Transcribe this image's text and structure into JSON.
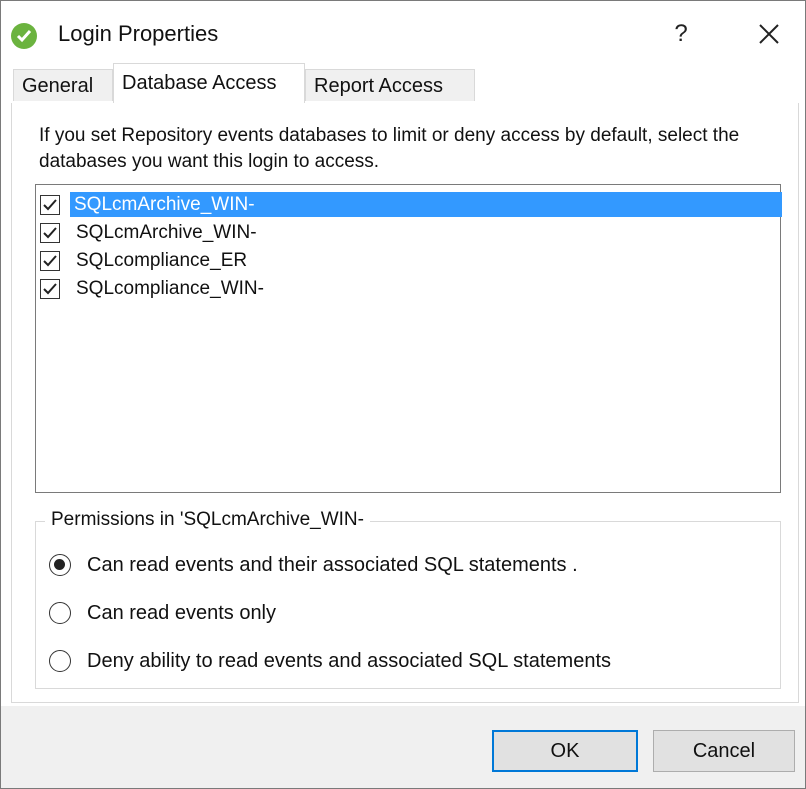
{
  "window": {
    "title": "Login Properties",
    "help_glyph": "?",
    "accent_color": "#6bb33f"
  },
  "tabs": [
    {
      "label": "General",
      "active": false
    },
    {
      "label": "Database Access",
      "active": true
    },
    {
      "label": "Report Access",
      "active": false
    }
  ],
  "database_access": {
    "description": "If you set Repository events databases to limit or deny access by default, select the databases you want this login to access.",
    "databases": [
      {
        "name": "SQLcmArchive_WIN-",
        "checked": true,
        "selected": true
      },
      {
        "name": "SQLcmArchive_WIN-",
        "checked": true,
        "selected": false
      },
      {
        "name": "SQLcompliance_ER",
        "checked": true,
        "selected": false
      },
      {
        "name": "SQLcompliance_WIN-",
        "checked": true,
        "selected": false
      }
    ],
    "permissions": {
      "legend": "Permissions in 'SQLcmArchive_WIN-",
      "options": [
        {
          "label": "Can read events and their associated SQL statements .",
          "selected": true
        },
        {
          "label": "Can read events only",
          "selected": false
        },
        {
          "label": "Deny ability to read events and associated SQL statements",
          "selected": false
        }
      ]
    }
  },
  "buttons": {
    "ok": "OK",
    "cancel": "Cancel"
  },
  "icons": {
    "app": "check-circle-icon",
    "close": "close-icon"
  }
}
